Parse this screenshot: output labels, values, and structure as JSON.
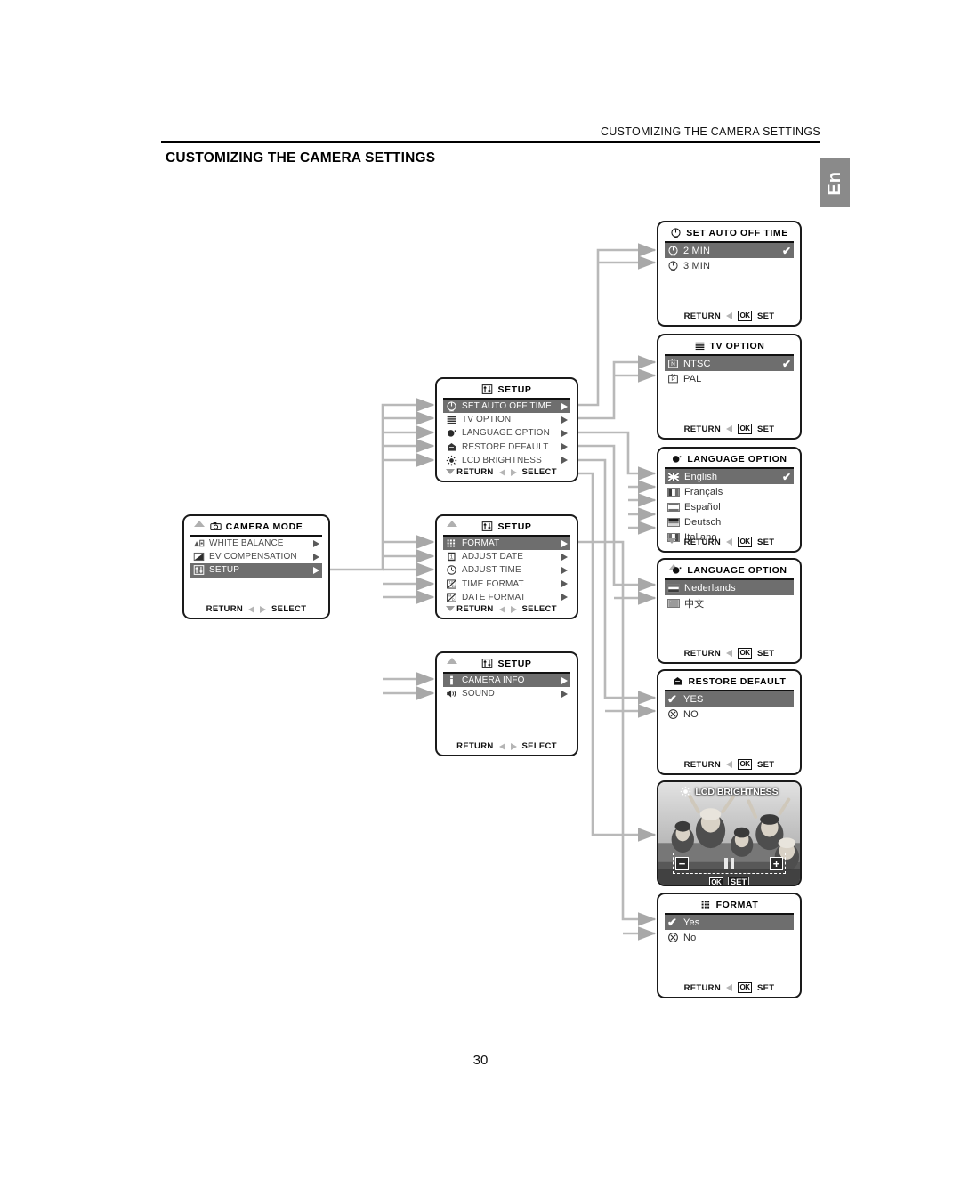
{
  "header": {
    "running_head": "CUSTOMIZING THE CAMERA SETTINGS",
    "title": "CUSTOMIZING THE CAMERA SETTINGS",
    "language_tab": "En"
  },
  "page_number": "30",
  "footer_common": {
    "return": "RETURN",
    "select": "SELECT",
    "set": "SET",
    "ok": "OK"
  },
  "screens": {
    "camera_mode": {
      "title": "CAMERA MODE",
      "title_icon": "camera-icon",
      "has_up_caret": true,
      "rows": [
        {
          "label": "WHITE BALANCE",
          "icon": "white-balance-icon",
          "selected": false,
          "arrow": true
        },
        {
          "label": "EV COMPENSATION",
          "icon": "ev-compensation-icon",
          "selected": false,
          "arrow": true
        },
        {
          "label": "SETUP",
          "icon": "setup-icon",
          "selected": true,
          "arrow": true
        }
      ],
      "footer": {
        "left": "RETURN",
        "right": "SELECT"
      }
    },
    "setup_page1": {
      "title": "SETUP",
      "title_icon": "setup-icon",
      "has_up_caret": false,
      "rows": [
        {
          "label": "SET AUTO OFF TIME",
          "icon": "auto-off-clock-icon",
          "selected": true,
          "arrow": true
        },
        {
          "label": "TV OPTION",
          "icon": "tv-lines-icon",
          "selected": false,
          "arrow": true
        },
        {
          "label": "LANGUAGE OPTION",
          "icon": "language-globe-icon",
          "selected": false,
          "arrow": true
        },
        {
          "label": "RESTORE DEFAULT",
          "icon": "restore-default-icon",
          "selected": false,
          "arrow": true
        },
        {
          "label": "LCD BRIGHTNESS",
          "icon": "brightness-sun-icon",
          "selected": false,
          "arrow": true
        }
      ],
      "footer": {
        "left": "RETURN",
        "right": "SELECT",
        "down_caret": true
      }
    },
    "setup_page2": {
      "title": "SETUP",
      "title_icon": "setup-icon",
      "has_up_caret": true,
      "rows": [
        {
          "label": "FORMAT",
          "icon": "format-grid-icon",
          "selected": true,
          "arrow": true
        },
        {
          "label": "ADJUST DATE",
          "icon": "calendar-icon",
          "selected": false,
          "arrow": true
        },
        {
          "label": "ADJUST TIME",
          "icon": "clock-icon",
          "selected": false,
          "arrow": true
        },
        {
          "label": "TIME FORMAT",
          "icon": "time-format-icon",
          "selected": false,
          "arrow": true
        },
        {
          "label": "DATE FORMAT",
          "icon": "date-format-icon",
          "selected": false,
          "arrow": true
        }
      ],
      "footer": {
        "left": "RETURN",
        "right": "SELECT",
        "down_caret": true
      }
    },
    "setup_page3": {
      "title": "SETUP",
      "title_icon": "setup-icon",
      "has_up_caret": true,
      "rows": [
        {
          "label": "CAMERA INFO",
          "icon": "info-icon",
          "selected": true,
          "arrow": true
        },
        {
          "label": "SOUND",
          "icon": "sound-icon",
          "selected": false,
          "arrow": true
        }
      ],
      "footer": {
        "left": "RETURN",
        "right": "SELECT"
      }
    },
    "set_auto_off_time": {
      "title": "SET AUTO OFF TIME",
      "title_icon": "auto-off-clock-icon",
      "rows": [
        {
          "label": "2 MIN",
          "icon": "clock-icon",
          "selected": true,
          "check": true
        },
        {
          "label": "3 MIN",
          "icon": "clock-icon",
          "selected": false,
          "check": false
        }
      ],
      "footer": {
        "left": "RETURN",
        "right": "SET"
      }
    },
    "tv_option": {
      "title": "TV  OPTION",
      "title_icon": "tv-lines-icon",
      "rows": [
        {
          "label": "NTSC",
          "icon": "ntsc-icon",
          "selected": true,
          "check": true
        },
        {
          "label": "PAL",
          "icon": "pal-icon",
          "selected": false,
          "check": false
        }
      ],
      "footer": {
        "left": "RETURN",
        "right": "SET"
      }
    },
    "language_option_page1": {
      "title": "LANGUAGE  OPTION",
      "title_icon": "language-globe-icon",
      "rows": [
        {
          "label": "English",
          "icon": "flag-uk-icon",
          "selected": true,
          "check": true
        },
        {
          "label": "Français",
          "icon": "flag-france-icon",
          "selected": false,
          "check": false
        },
        {
          "label": "Español",
          "icon": "flag-spain-icon",
          "selected": false,
          "check": false
        },
        {
          "label": "Deutsch",
          "icon": "flag-germany-icon",
          "selected": false,
          "check": false
        },
        {
          "label": "Italiano",
          "icon": "flag-italy-icon",
          "selected": false,
          "check": false
        }
      ],
      "footer": {
        "left": "RETURN",
        "right": "SET",
        "down_caret": true
      }
    },
    "language_option_page2": {
      "title": "LANGUAGE  OPTION",
      "title_icon": "language-globe-icon",
      "has_up_caret": true,
      "rows": [
        {
          "label": "Nederlands",
          "icon": "flag-netherlands-icon",
          "selected": true,
          "check": false
        },
        {
          "label": "中文",
          "icon": "flag-china-icon",
          "selected": false,
          "check": false
        }
      ],
      "footer": {
        "left": "RETURN",
        "right": "SET"
      }
    },
    "restore_default": {
      "title": "RESTORE DEFAULT",
      "title_icon": "restore-default-icon",
      "rows": [
        {
          "label": "YES",
          "icon": "check-icon",
          "selected": true,
          "check": false
        },
        {
          "label": "NO",
          "icon": "x-circle-icon",
          "selected": false,
          "check": false
        }
      ],
      "footer": {
        "left": "RETURN",
        "right": "SET"
      }
    },
    "lcd_brightness": {
      "title": "LCD BRIGHTNESS",
      "title_icon": "brightness-sun-icon",
      "minus": "−",
      "plus": "+",
      "ok": "OK",
      "set": "SET"
    },
    "format": {
      "title": "FORMAT",
      "title_icon": "format-grid-icon",
      "rows": [
        {
          "label": "Yes",
          "icon": "check-icon",
          "selected": true,
          "check": false
        },
        {
          "label": "No",
          "icon": "x-circle-icon",
          "selected": false,
          "check": false
        }
      ],
      "footer": {
        "left": "RETURN",
        "right": "SET"
      }
    }
  }
}
